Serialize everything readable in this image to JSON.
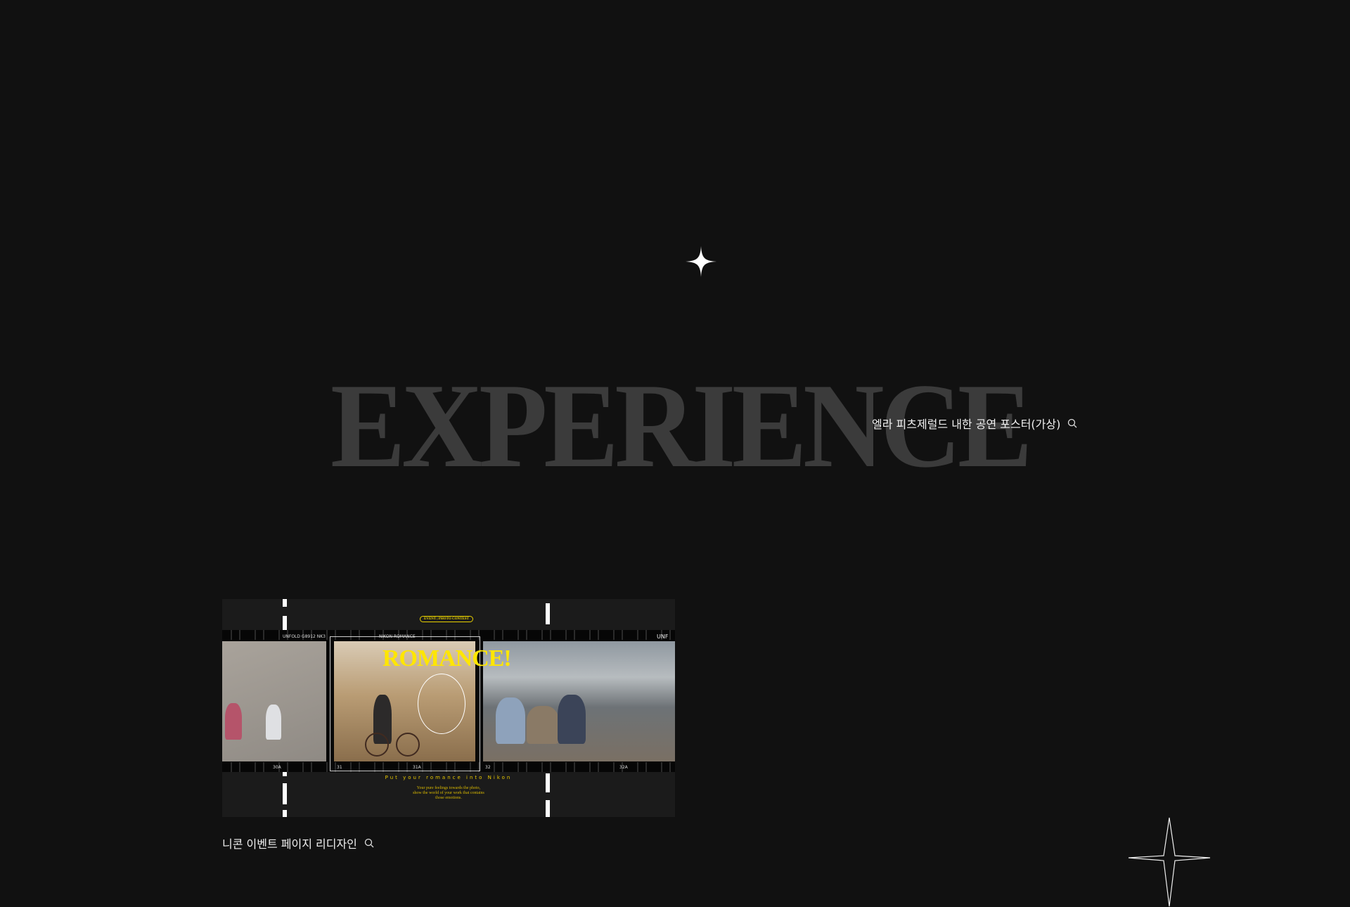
{
  "hero": {
    "title": "EXPERIENCE"
  },
  "projects": [
    {
      "label": "엘라 피츠제럴드 내한 공연 포스터(가상)",
      "icon": "search-icon"
    },
    {
      "label": "니콘 이벤트 페이지 리디자인",
      "icon": "search-icon"
    }
  ],
  "film": {
    "badge": "EVENT | PHOTO CONTEST",
    "headline": "ROMANCE!",
    "frame_labels": [
      "UNFOLD G8912 NK3",
      "NIKON ROMANCE",
      "UNF"
    ],
    "frame_numbers": [
      "30A",
      "31",
      "31A",
      "32",
      "32A"
    ],
    "tagline": "Put your romance into Nikon",
    "description": [
      "Your pure feelings towards the photo,",
      "show the world of your work that contains",
      "those emotions."
    ]
  },
  "colors": {
    "background": "#111111",
    "title": "#3b3b3b",
    "accent": "#ffe600"
  }
}
